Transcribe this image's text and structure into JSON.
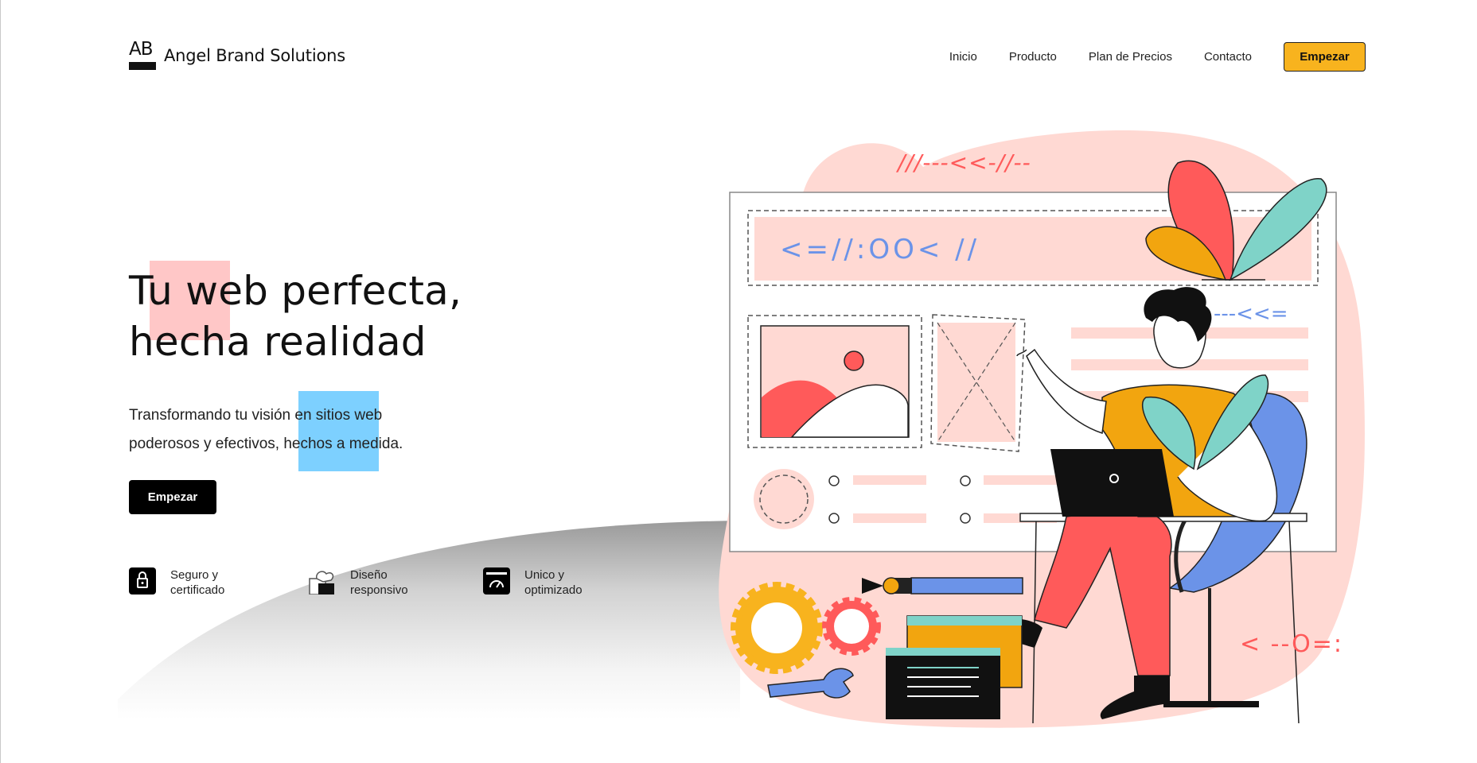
{
  "header": {
    "logo_mark": "AB",
    "brand": "Angel Brand Solutions",
    "nav": [
      "Inicio",
      "Producto",
      "Plan de Precios",
      "Contacto"
    ],
    "cta": "Empezar"
  },
  "hero": {
    "title_line1": "Tu web perfecta,",
    "title_line2": "hecha realidad",
    "subtitle": "Transformando tu visión en sitios web poderosos y efectivos, hechos a medida.",
    "cta": "Empezar"
  },
  "features": [
    {
      "label": "Seguro y certificado",
      "icon": "lock-icon"
    },
    {
      "label": "Diseño responsivo",
      "icon": "puzzle-icon"
    },
    {
      "label": "Unico y optimizado",
      "icon": "speedometer-icon"
    }
  ],
  "illustration": {
    "deco_top": "///---<<-//--",
    "deco_banner": "<=//:OO< //",
    "deco_right": "---<<=",
    "deco_bottom": "< --O=:"
  },
  "colors": {
    "accent": "#f8b31e",
    "pink": "#ffd9d3",
    "coral": "#ff5a5a",
    "teal": "#7fd3c8",
    "blue": "#6b93e8",
    "yellow": "#f2a50f"
  }
}
